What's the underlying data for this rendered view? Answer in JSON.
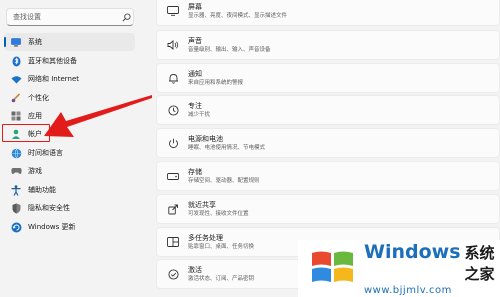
{
  "search": {
    "placeholder": "查找设置"
  },
  "sidebar": {
    "items": [
      {
        "label": "系统",
        "icon": "monitor-icon",
        "active": true
      },
      {
        "label": "蓝牙和其他设备",
        "icon": "bluetooth-icon"
      },
      {
        "label": "网络和 Internet",
        "icon": "wifi-icon"
      },
      {
        "label": "个性化",
        "icon": "brush-icon"
      },
      {
        "label": "应用",
        "icon": "apps-icon"
      },
      {
        "label": "帐户",
        "icon": "person-icon"
      },
      {
        "label": "时间和语言",
        "icon": "globe-clock-icon"
      },
      {
        "label": "游戏",
        "icon": "gamepad-icon"
      },
      {
        "label": "辅助功能",
        "icon": "accessibility-icon"
      },
      {
        "label": "隐私和安全性",
        "icon": "shield-icon"
      },
      {
        "label": "Windows 更新",
        "icon": "update-icon"
      }
    ]
  },
  "main": {
    "cards": [
      {
        "title": "屏幕",
        "subtitle": "显示器、亮度、夜间模式、显示描述文件",
        "icon": "display-icon"
      },
      {
        "title": "声音",
        "subtitle": "音量级别、输出、输入、声音设备",
        "icon": "speaker-icon"
      },
      {
        "title": "通知",
        "subtitle": "来自应用和系统的警报",
        "icon": "bell-icon"
      },
      {
        "title": "专注",
        "subtitle": "减少干扰",
        "icon": "focus-icon"
      },
      {
        "title": "电源和电池",
        "subtitle": "睡眠、电池使用情况、节电模式",
        "icon": "power-icon"
      },
      {
        "title": "存储",
        "subtitle": "存储空间、驱动器、配置规则",
        "icon": "storage-icon"
      },
      {
        "title": "就近共享",
        "subtitle": "可发现性、接收文件位置",
        "icon": "nearby-share-icon"
      },
      {
        "title": "多任务处理",
        "subtitle": "贴靠窗口、桌面、任务切换",
        "icon": "multitask-icon"
      },
      {
        "title": "激活",
        "subtitle": "激活状态、订阅、产品密钥",
        "icon": "activation-icon"
      }
    ]
  },
  "watermark": {
    "brand": "Windows",
    "cn": "系统之家",
    "url": "www.bjjmlv.com"
  },
  "colors": {
    "accent": "#005fb8",
    "arrow": "#e21b1b",
    "watermark_blue": "#1c6fb8"
  }
}
